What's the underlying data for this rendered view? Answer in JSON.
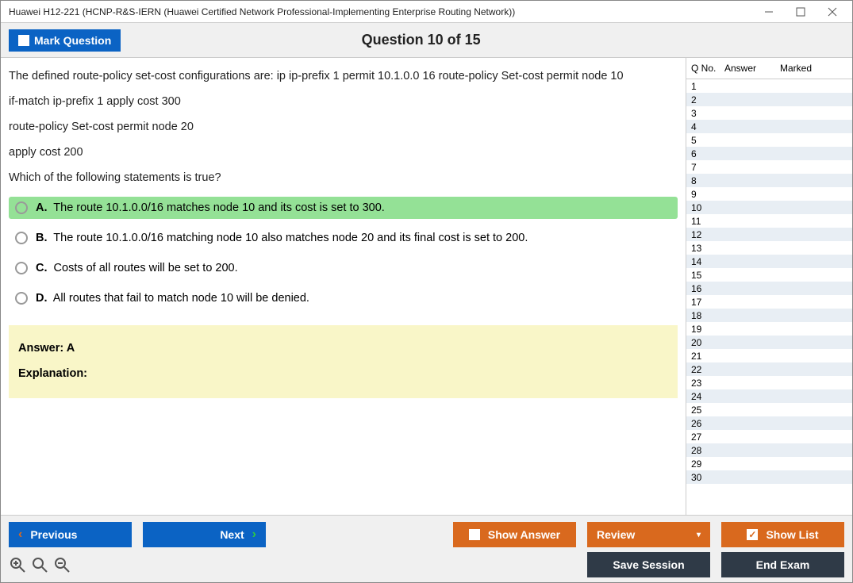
{
  "window": {
    "title": "Huawei H12-221 (HCNP-R&S-IERN (Huawei Certified Network Professional-Implementing Enterprise Routing Network))"
  },
  "header": {
    "mark_label": "Mark Question",
    "counter": "Question 10 of 15"
  },
  "question": {
    "lines": [
      "The defined route-policy set-cost configurations are: ip ip-prefix 1 permit 10.1.0.0 16 route-policy Set-cost permit node 10",
      "if-match ip-prefix 1 apply cost 300",
      "route-policy Set-cost permit node 20",
      "apply cost 200",
      "Which of the following statements is true?"
    ],
    "options": [
      {
        "letter": "A.",
        "text": "The route 10.1.0.0/16 matches node 10 and its cost is set to 300.",
        "correct": true
      },
      {
        "letter": "B.",
        "text": "The route 10.1.0.0/16 matching node 10 also matches node 20 and its final cost is set to 200.",
        "correct": false
      },
      {
        "letter": "C.",
        "text": "Costs of all routes will be set to 200.",
        "correct": false
      },
      {
        "letter": "D.",
        "text": "All routes that fail to match node 10 will be denied.",
        "correct": false
      }
    ],
    "answer_label": "Answer: A",
    "explanation_label": "Explanation:"
  },
  "side": {
    "col_qno": "Q No.",
    "col_answer": "Answer",
    "col_marked": "Marked",
    "rows": [
      1,
      2,
      3,
      4,
      5,
      6,
      7,
      8,
      9,
      10,
      11,
      12,
      13,
      14,
      15,
      16,
      17,
      18,
      19,
      20,
      21,
      22,
      23,
      24,
      25,
      26,
      27,
      28,
      29,
      30
    ]
  },
  "footer": {
    "previous": "Previous",
    "next": "Next",
    "show_answer": "Show Answer",
    "review": "Review",
    "show_list": "Show List",
    "save_session": "Save Session",
    "end_exam": "End Exam"
  }
}
